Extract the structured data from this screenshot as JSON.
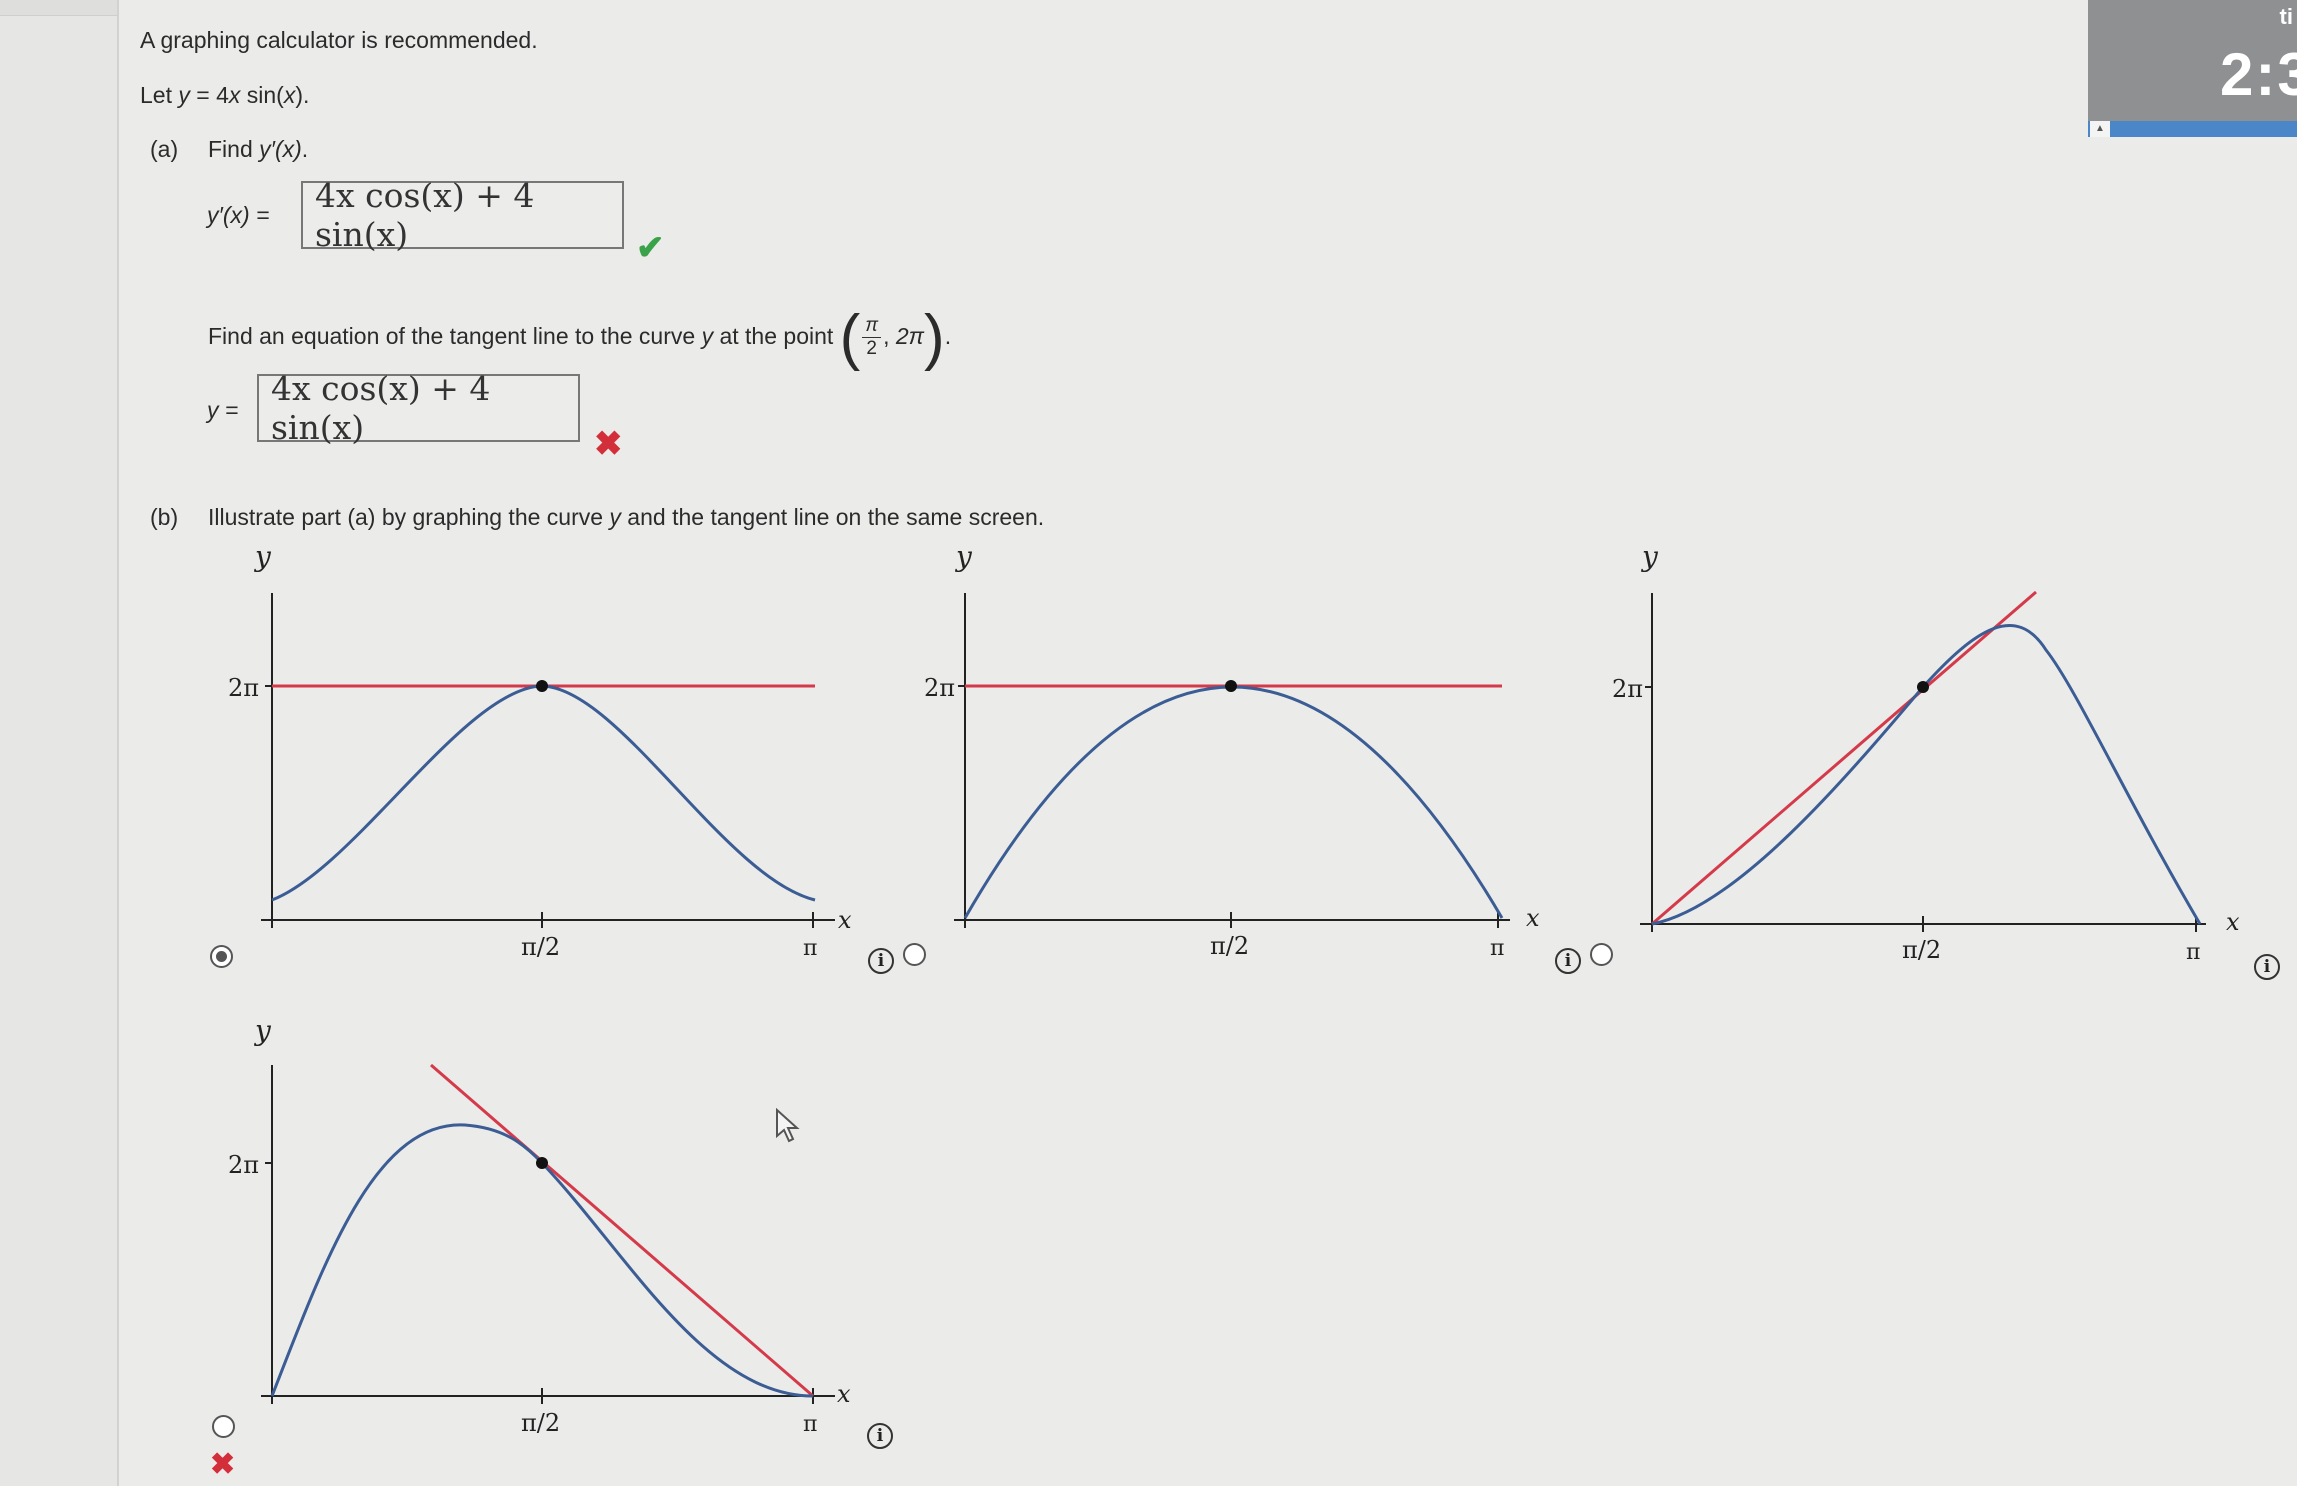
{
  "intro": "A graphing calculator is recommended.",
  "given": {
    "prefix": "Let ",
    "var": "y",
    "eq": " = 4",
    "x": "x",
    "rest": " sin(",
    "arg": "x",
    "end": ")."
  },
  "part_a": {
    "label": "(a)",
    "prompt_prefix": "Find ",
    "prompt_fn": "y′(x)",
    "prompt_end": ".",
    "deriv_label": "y′(x) =",
    "deriv_answer": "4x cos(x) + 4 sin(x)",
    "deriv_status": "✔",
    "tangent_prompt": "Find an equation of the tangent line to the curve ",
    "tangent_var": "y",
    "tangent_mid": " at the point ",
    "point_num": "π",
    "point_den": "2",
    "point_y": "2π",
    "point_end": ".",
    "tangent_label": "y =",
    "tangent_answer": "4x cos(x) + 4 sin(x)",
    "tangent_status": "✖"
  },
  "part_b": {
    "label": "(b)",
    "prompt_a": "Illustrate part (a) by graphing the curve ",
    "prompt_var": "y",
    "prompt_b": " and the tangent line on the same screen.",
    "axis_y": "y",
    "axis_x": "x",
    "tick_y": "2π",
    "tick_mid": "π/2",
    "tick_end": "π",
    "info_icon": "i",
    "status_wrong": "✖",
    "options": [
      {
        "id": "A",
        "selected": true,
        "shape": "symmetric-bell",
        "tangent": "horizontal"
      },
      {
        "id": "B",
        "selected": false,
        "shape": "parabola-arch",
        "tangent": "horizontal"
      },
      {
        "id": "C",
        "selected": false,
        "shape": "right-skewed-peak",
        "tangent": "positive-slope"
      },
      {
        "id": "D",
        "selected": false,
        "shape": "left-skewed-peak",
        "tangent": "negative-slope"
      }
    ]
  },
  "timer": {
    "label": "ti",
    "value": "2:3"
  },
  "colors": {
    "curve": "#3b5d94",
    "tangent": "#d43a4a",
    "correct": "#3aa34a",
    "wrong": "#d32f3a"
  },
  "icons": [
    "check-icon",
    "cross-icon",
    "info-icon",
    "radio-button",
    "cursor-icon"
  ]
}
